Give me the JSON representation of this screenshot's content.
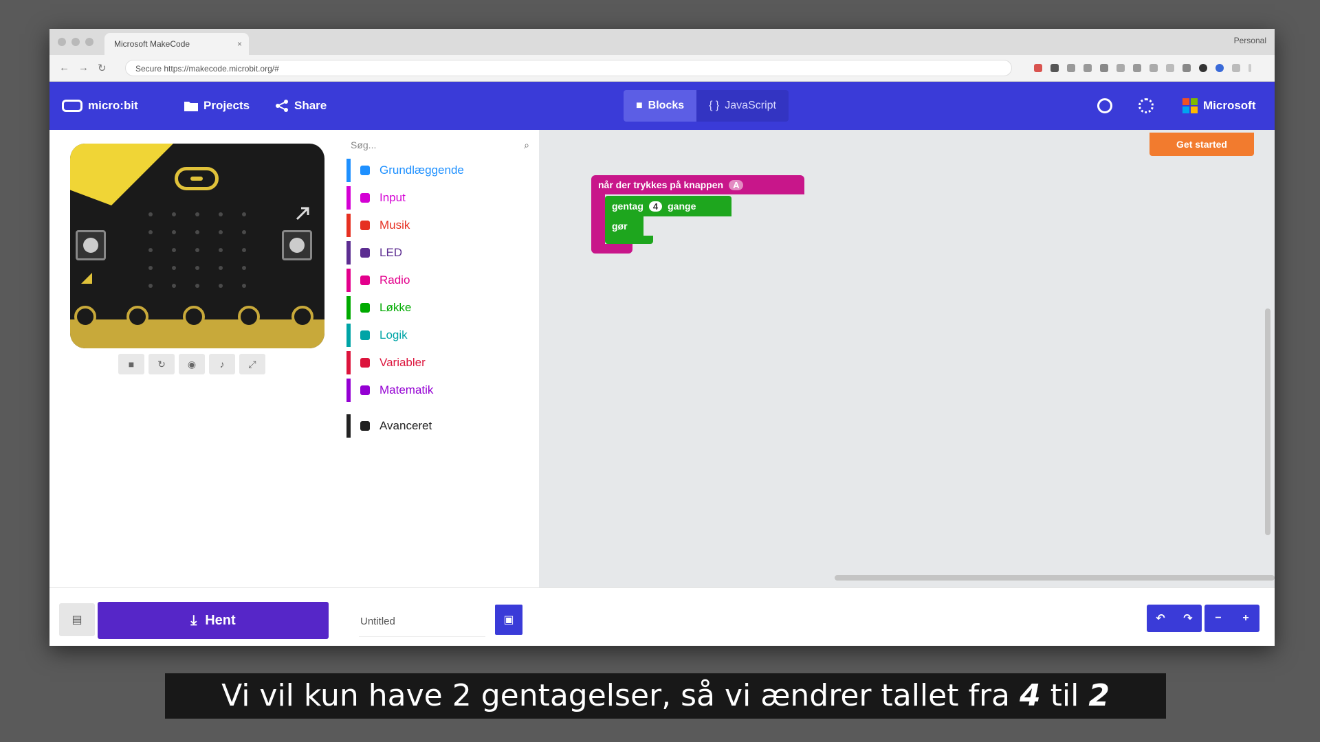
{
  "browser": {
    "tab_title": "Microsoft MakeCode",
    "tab_close": "×",
    "profile": "Personal",
    "url": "Secure  https://makecode.microbit.org/#",
    "nav": {
      "back": "←",
      "forward": "→",
      "reload": "↻"
    }
  },
  "header": {
    "logo_text": "micro:bit",
    "projects_label": "Projects",
    "share_label": "Share",
    "blocks_label": "Blocks",
    "javascript_label": "JavaScript",
    "microsoft_label": "Microsoft",
    "colors": {
      "bar": "#3a3bd8",
      "active": "#5c5ee5"
    }
  },
  "simulator": {
    "controls": [
      "■",
      "↻",
      "◉",
      "♪",
      "⤢"
    ],
    "colors": {
      "board": "#1a1a1a",
      "accent": "#f0d536",
      "pins": "#c8a93a"
    }
  },
  "toolbox": {
    "search_placeholder": "Søg...",
    "search_icon": "⌕",
    "categories": [
      {
        "label": "Grundlæggende",
        "color": "#1e90ff"
      },
      {
        "label": "Input",
        "color": "#d400d4"
      },
      {
        "label": "Musik",
        "color": "#e63022"
      },
      {
        "label": "LED",
        "color": "#5c2d91"
      },
      {
        "label": "Radio",
        "color": "#e3008c"
      },
      {
        "label": "Løkke",
        "color": "#00aa00"
      },
      {
        "label": "Logik",
        "color": "#00a4a6"
      },
      {
        "label": "Variabler",
        "color": "#dc143c"
      },
      {
        "label": "Matematik",
        "color": "#9400d3"
      },
      {
        "label": "Avanceret",
        "color": "#222222"
      }
    ]
  },
  "workspace": {
    "get_started": "Get started",
    "event_block": "når der trykkes på knappen",
    "event_value": "A",
    "repeat_label": "gentag",
    "repeat_count": "4",
    "repeat_suffix": "gange",
    "do_label": "gør"
  },
  "footer": {
    "download_label": "Hent",
    "download_icon": "⤓",
    "project_name": "Untitled",
    "save_icon": "💾",
    "undo_icon": "↶",
    "redo_icon": "↷",
    "zoom_out_icon": "−",
    "zoom_in_icon": "+"
  },
  "subtitle": {
    "prefix": "Vi vil kun have 2 gentagelser, så vi ændrer tallet fra ",
    "from": "4",
    "middle": " til ",
    "to": "2"
  }
}
